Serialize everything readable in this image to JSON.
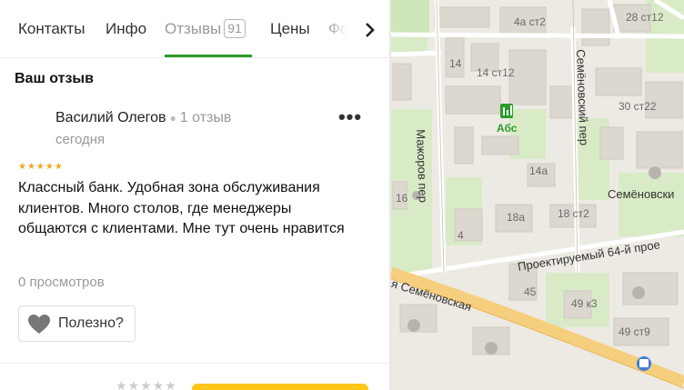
{
  "tabs": {
    "items": [
      {
        "label": "Контакты"
      },
      {
        "label": "Инфо"
      },
      {
        "label": "Отзывы",
        "count": "91"
      },
      {
        "label": "Цены"
      },
      {
        "label": "Фо"
      }
    ],
    "next_icon": "chevron-right-icon"
  },
  "review_section": {
    "title": "Ваш отзыв"
  },
  "review": {
    "author": "Василий Олегов",
    "author_reviews": "1 отзыв",
    "date": "сегодня",
    "more_icon": "more-dots-icon",
    "rating": 5,
    "stars": "★★★★★",
    "text": "Классный банк. Удобная зона обслуживания клиентов. Много столов, где менеджеры общаются с клиентами. Мне тут очень нравится",
    "views": "0 просмотров",
    "useful_label": "Полезно?",
    "useful_icon": "heart-icon"
  },
  "rate": {
    "stars": "★★★★★"
  },
  "colors": {
    "accent_green": "#2a9d2a",
    "star": "#f5a623",
    "cta": "#ffc51a",
    "map_green": "#cfe6b8",
    "road_major": "#f6cf7e"
  },
  "map": {
    "street_labels": [
      "Мажоров пер",
      "Семёновский пер",
      "Проектируемый 64-й прое",
      "ая Семёновская"
    ],
    "building_labels": [
      "4а ст2",
      "28 ст12",
      "14",
      "14 ст12",
      "30 ст22",
      "14а",
      "16",
      "18а",
      "18 ст2",
      "4",
      "45",
      "49 к3",
      "49 ст9",
      "Семёновски"
    ],
    "poi_label": "Абс"
  }
}
